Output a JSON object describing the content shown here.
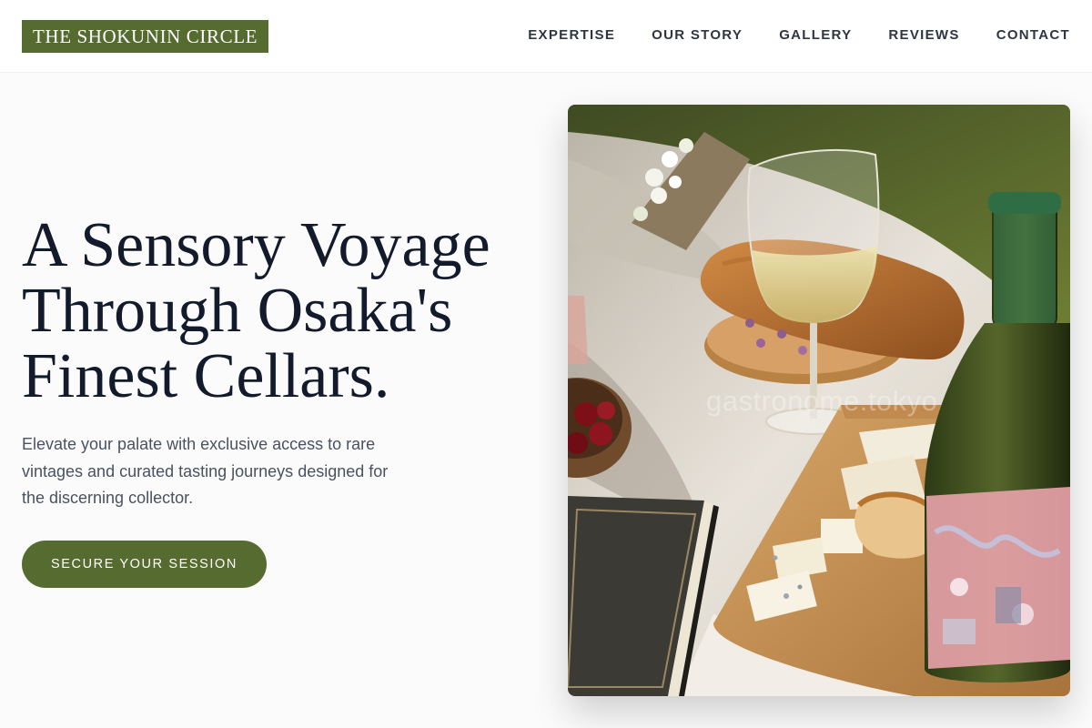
{
  "header": {
    "logo_text": "THE SHOKUNIN CIRCLE",
    "nav": [
      {
        "label": "EXPERTISE"
      },
      {
        "label": "OUR STORY"
      },
      {
        "label": "GALLERY"
      },
      {
        "label": "REVIEWS"
      },
      {
        "label": "CONTACT"
      }
    ]
  },
  "hero": {
    "title_lines": [
      "A Sensory Voyage",
      "Through Osaka's",
      "Finest Cellars."
    ],
    "subtitle_lines": [
      "Elevate your palate with exclusive access to rare",
      "vintages and curated tasting journeys designed for",
      "the discerning collector."
    ],
    "cta_label": "SECURE YOUR SESSION",
    "image": {
      "watermark": "gastronome.tokyo",
      "depicts": [
        "white-wine-glass",
        "wine-bottle",
        "bread",
        "cheese-board",
        "cherries-bowl",
        "flowers",
        "book",
        "picnic-blanket",
        "grass"
      ]
    }
  },
  "colors": {
    "brand": "#566b2f",
    "heading": "#121a2b",
    "body_text": "#4a5160",
    "nav_text": "#2f3542",
    "page_bg": "#fbfbfb",
    "header_bg": "#ffffff"
  }
}
